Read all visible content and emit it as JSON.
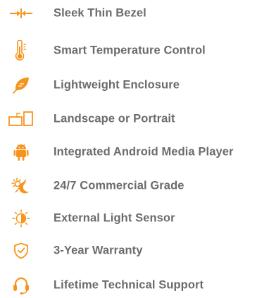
{
  "accent_color": "#f7941d",
  "text_color": "#6b6b6b",
  "features": [
    {
      "label": "Sleek Thin Bezel",
      "icon": "thin-bezel-arrows-icon"
    },
    {
      "label": "Smart Temperature Control",
      "icon": "thermometer-icon"
    },
    {
      "label": "Lightweight Enclosure",
      "icon": "feather-icon"
    },
    {
      "label": "Landscape or Portrait",
      "icon": "screen-rotate-icon"
    },
    {
      "label": "Integrated Android Media Player",
      "icon": "android-icon"
    },
    {
      "label": "24/7 Commercial Grade",
      "icon": "sun-moon-icon"
    },
    {
      "label": "External Light Sensor",
      "icon": "light-sensor-icon"
    },
    {
      "label": "3-Year Warranty",
      "icon": "shield-check-icon"
    },
    {
      "label": "Lifetime Technical Support",
      "icon": "headset-icon"
    }
  ]
}
